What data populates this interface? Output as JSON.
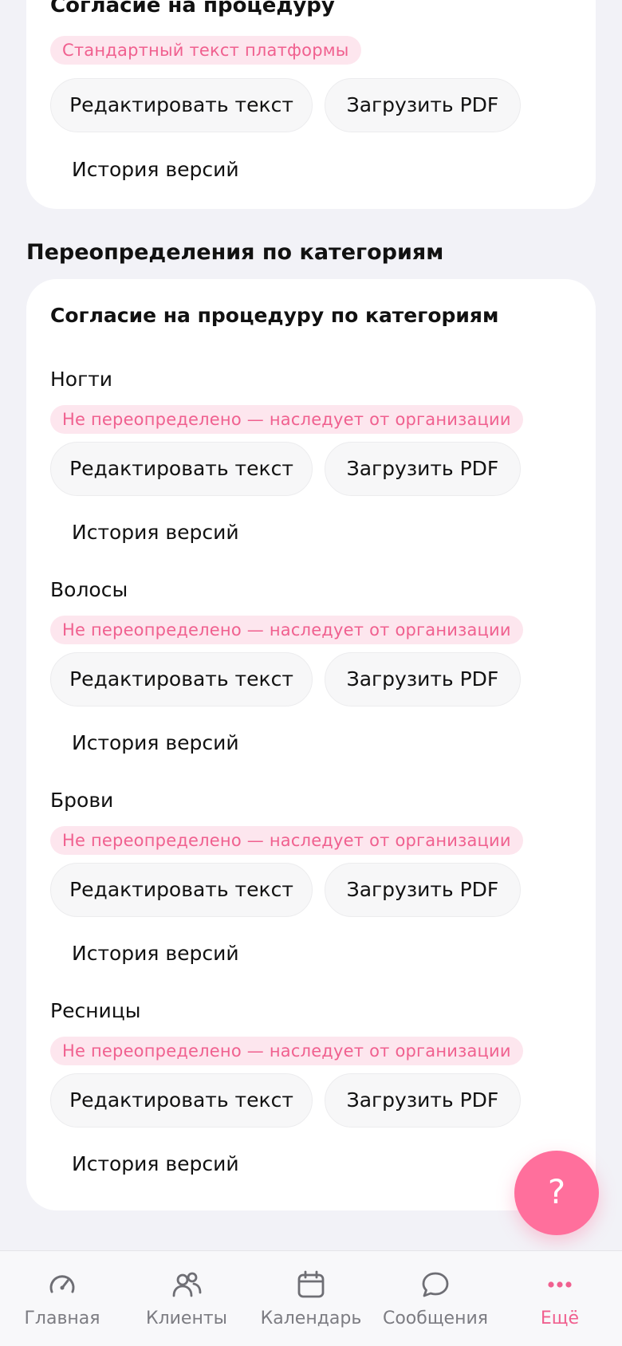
{
  "top_card": {
    "title": "Согласие на процедуру",
    "badge": "Стандартный текст платформы",
    "edit_button": "Редактировать текст",
    "pdf_button": "Загрузить PDF",
    "history_link": "История версий"
  },
  "overrides": {
    "section_title": "Переопределения по категориям",
    "card_title": "Согласие на процедуру по категориям",
    "categories": [
      {
        "name": "Ногти",
        "status": "Не переопределено — наследует от организации",
        "edit_button": "Редактировать текст",
        "pdf_button": "Загрузить PDF",
        "history_link": "История версий"
      },
      {
        "name": "Волосы",
        "status": "Не переопределено — наследует от организации",
        "edit_button": "Редактировать текст",
        "pdf_button": "Загрузить PDF",
        "history_link": "История версий"
      },
      {
        "name": "Брови",
        "status": "Не переопределено — наследует от организации",
        "edit_button": "Редактировать текст",
        "pdf_button": "Загрузить PDF",
        "history_link": "История версий"
      },
      {
        "name": "Ресницы",
        "status": "Не переопределено — наследует от организации",
        "edit_button": "Редактировать текст",
        "pdf_button": "Загрузить PDF",
        "history_link": "История версий"
      }
    ]
  },
  "fab": {
    "label": "?",
    "icon": "help-icon"
  },
  "tabbar": {
    "tabs": [
      {
        "label": "Главная",
        "icon": "gauge-icon",
        "active": false
      },
      {
        "label": "Клиенты",
        "icon": "users-icon",
        "active": false
      },
      {
        "label": "Календарь",
        "icon": "calendar-icon",
        "active": false
      },
      {
        "label": "Сообщения",
        "icon": "chat-bubble-icon",
        "active": false
      },
      {
        "label": "Ещё",
        "icon": "more-dots-icon",
        "active": true
      }
    ]
  },
  "colors": {
    "accent": "#f0608f",
    "badge_bg": "#fde6ee",
    "fab": "#ff6f9c",
    "background": "#f2f2f7",
    "tab_inactive": "#7c7c82"
  }
}
